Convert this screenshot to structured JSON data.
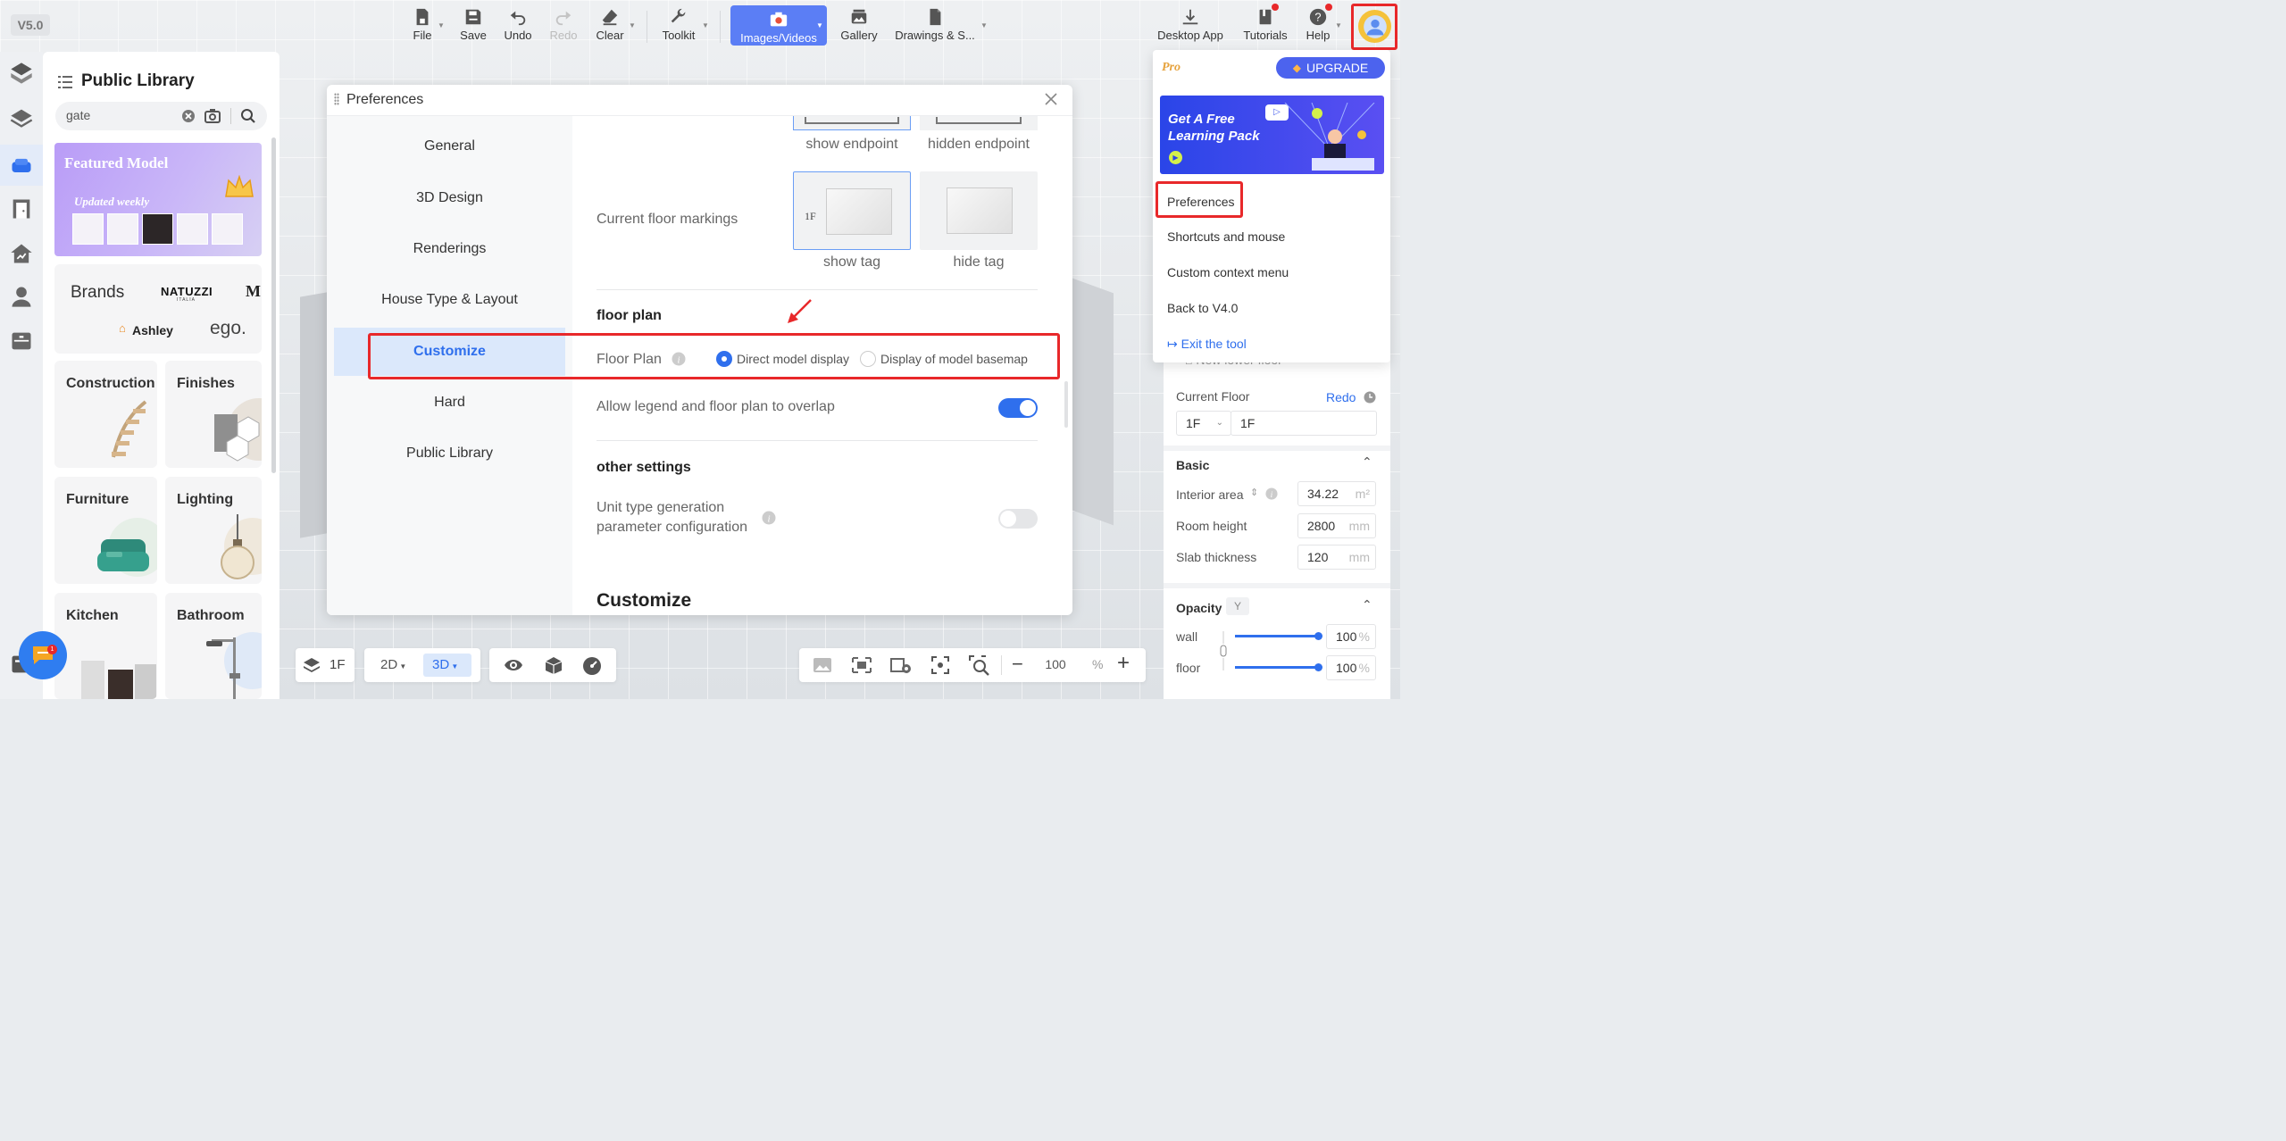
{
  "version": "V5.0",
  "toolbar": {
    "file": "File",
    "save": "Save",
    "undo": "Undo",
    "redo": "Redo",
    "clear": "Clear",
    "toolkit": "Toolkit",
    "images_videos": "Images/Videos",
    "gallery": "Gallery",
    "drawings": "Drawings & S...",
    "desktop_app": "Desktop App",
    "tutorials": "Tutorials",
    "help": "Help"
  },
  "library": {
    "title": "Public Library",
    "search_value": "gate",
    "featured": {
      "title": "Featured Model",
      "subtitle": "Updated weekly"
    },
    "brands": {
      "label": "Brands",
      "natuzzi": "NATUZZI",
      "natuzzi_sub": "ITALIA",
      "m": "M",
      "ashley": "Ashley",
      "ego": "ego."
    },
    "categories": [
      "Construction",
      "Finishes",
      "Furniture",
      "Lighting",
      "Kitchen",
      "Bathroom"
    ],
    "chat_badge": "1"
  },
  "dialog": {
    "title": "Preferences",
    "nav": [
      "General",
      "3D Design",
      "Renderings",
      "House Type & Layout",
      "Customize",
      "Hard",
      "Public Library"
    ],
    "active_nav": "Customize",
    "endpoint_options": [
      "show endpoint",
      "hidden endpoint"
    ],
    "current_floor_markings": {
      "label": "Current floor markings",
      "options": [
        "show tag",
        "hide tag"
      ],
      "thumb_tag": "1F"
    },
    "floor_plan_section": "floor plan",
    "floor_plan": {
      "label": "Floor Plan",
      "options": [
        "Direct model display",
        "Display of model basemap"
      ],
      "selected": "Direct model display"
    },
    "overlap": {
      "label": "Allow legend and floor plan to overlap",
      "enabled": true
    },
    "other_settings": "other settings",
    "unit_type": {
      "label_line1": "Unit type generation",
      "label_line2": "parameter configuration",
      "enabled": false
    },
    "customize_heading": "Customize"
  },
  "menu": {
    "pro": "Pro",
    "upgrade": "UPGRADE",
    "banner": {
      "line1": "Get A Free",
      "line2": "Learning Pack"
    },
    "items": [
      "Preferences",
      "Shortcuts and mouse",
      "Custom context menu",
      "Back to V4.0"
    ],
    "exit": "Exit the tool"
  },
  "right_panel": {
    "new_lower_floor": "New lower floor",
    "current_floor": "Current Floor",
    "redo": "Redo",
    "floor_select": "1F",
    "floor_name": "1F",
    "basic": "Basic",
    "interior_area": {
      "label": "Interior area",
      "value": "34.22",
      "unit": "m²"
    },
    "room_height": {
      "label": "Room height",
      "value": "2800",
      "unit": "mm"
    },
    "slab_thickness": {
      "label": "Slab thickness",
      "value": "120",
      "unit": "mm"
    },
    "opacity": "Opacity",
    "opacity_key": "Y",
    "wall": {
      "label": "wall",
      "value": "100",
      "unit": "%",
      "level": 1.0
    },
    "floor": {
      "label": "floor",
      "value": "100",
      "unit": "%",
      "level": 1.0
    }
  },
  "bottom": {
    "floor": "1F",
    "view2d": "2D",
    "view3d": "3D",
    "zoom": "100",
    "zoom_unit": "%"
  },
  "colors": {
    "accent": "#2f6fed",
    "highlight_red": "#e8282a",
    "nav_active_bg": "#dbe8fb"
  }
}
